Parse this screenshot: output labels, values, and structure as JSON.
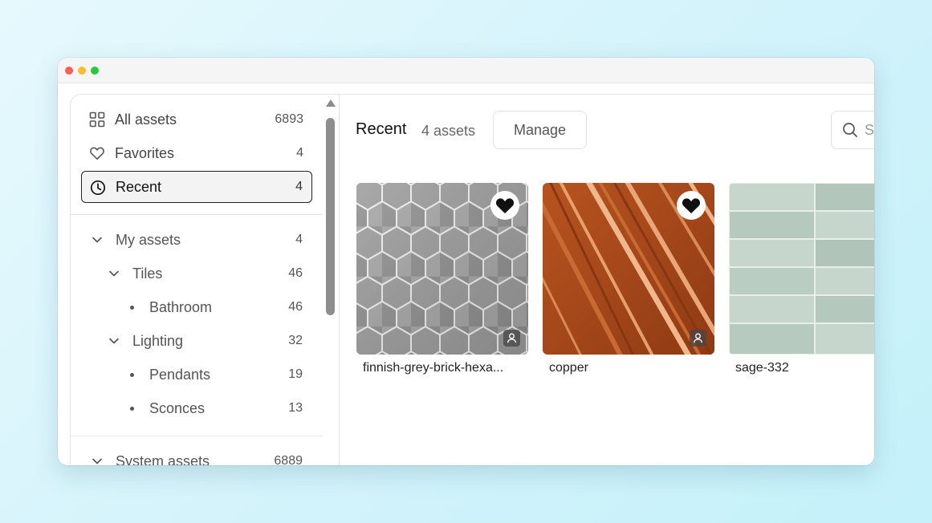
{
  "sidebar": {
    "top_items": [
      {
        "label": "All assets",
        "count": "6893",
        "icon": "grid-icon"
      },
      {
        "label": "Favorites",
        "count": "4",
        "icon": "heart-icon"
      },
      {
        "label": "Recent",
        "count": "4",
        "icon": "clock-icon",
        "active": true
      }
    ],
    "my_assets": {
      "label": "My assets",
      "count": "4"
    },
    "tiles": {
      "label": "Tiles",
      "count": "46"
    },
    "bathroom": {
      "label": "Bathroom",
      "count": "46"
    },
    "lighting": {
      "label": "Lighting",
      "count": "32"
    },
    "pendants": {
      "label": "Pendants",
      "count": "19"
    },
    "sconces": {
      "label": "Sconces",
      "count": "13"
    },
    "system_assets": {
      "label": "System assets",
      "count": "6889"
    }
  },
  "main": {
    "title": "Recent",
    "subtitle": "4 assets",
    "manage_label": "Manage",
    "search_placeholder": "Search"
  },
  "cards": [
    {
      "name": "finnish-grey-brick-hexa...",
      "favorited": true
    },
    {
      "name": "copper",
      "favorited": true
    },
    {
      "name": "sage-332",
      "favorited": true
    }
  ],
  "colors": {
    "active_border": "#222222",
    "active_bg": "#f3f3f3",
    "window_bg": "#ffffff",
    "background_start": "#e6f9fd",
    "background_end": "#c4f1fa"
  }
}
